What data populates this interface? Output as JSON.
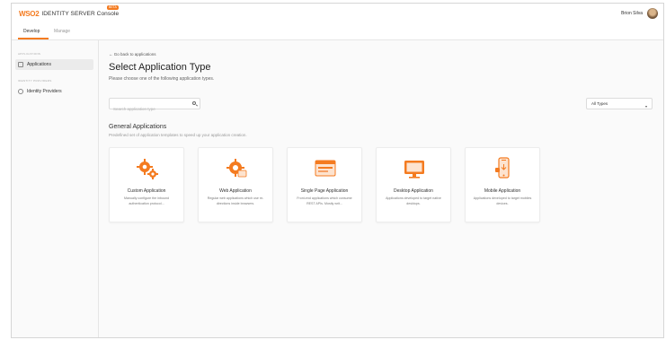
{
  "header": {
    "logo_mark": "WSO2",
    "logo_text": "IDENTITY SERVER Console",
    "beta": "BETA",
    "user_name": "Brion Silva"
  },
  "tabs": [
    {
      "label": "Develop",
      "active": true
    },
    {
      "label": "Manage",
      "active": false
    }
  ],
  "sidebar": {
    "section_applications": "APPLICATIONS",
    "item_applications": "Applications",
    "section_identity": "IDENTITY PROVIDERS",
    "item_identity": "Identity Providers"
  },
  "main": {
    "back_link": "← Go back to applications",
    "title": "Select Application Type",
    "subtitle": "Please choose one of the following application types.",
    "search_placeholder": "Search application type",
    "filter_value": "All Types",
    "section_title": "General Applications",
    "section_subtitle": "Predefined set of application templates to speed up your application creation."
  },
  "cards": [
    {
      "title": "Custom Application",
      "desc": "Manually configure the inbound authentication protocol...",
      "icon": "gears-icon"
    },
    {
      "title": "Web Application",
      "desc": "Regular web applications which use re-directions inside browsers.",
      "icon": "web-gear-icon"
    },
    {
      "title": "Single Page Application",
      "desc": "Front-end applications which consume REST APIs. Mostly writ...",
      "icon": "spa-window-icon"
    },
    {
      "title": "Desktop Application",
      "desc": "Applications developed to target native desktops.",
      "icon": "desktop-monitor-icon"
    },
    {
      "title": "Mobile Application",
      "desc": "Applications developed to target mobiles devices.",
      "icon": "mobile-phone-icon"
    }
  ],
  "colors": {
    "accent": "#f47b20"
  }
}
